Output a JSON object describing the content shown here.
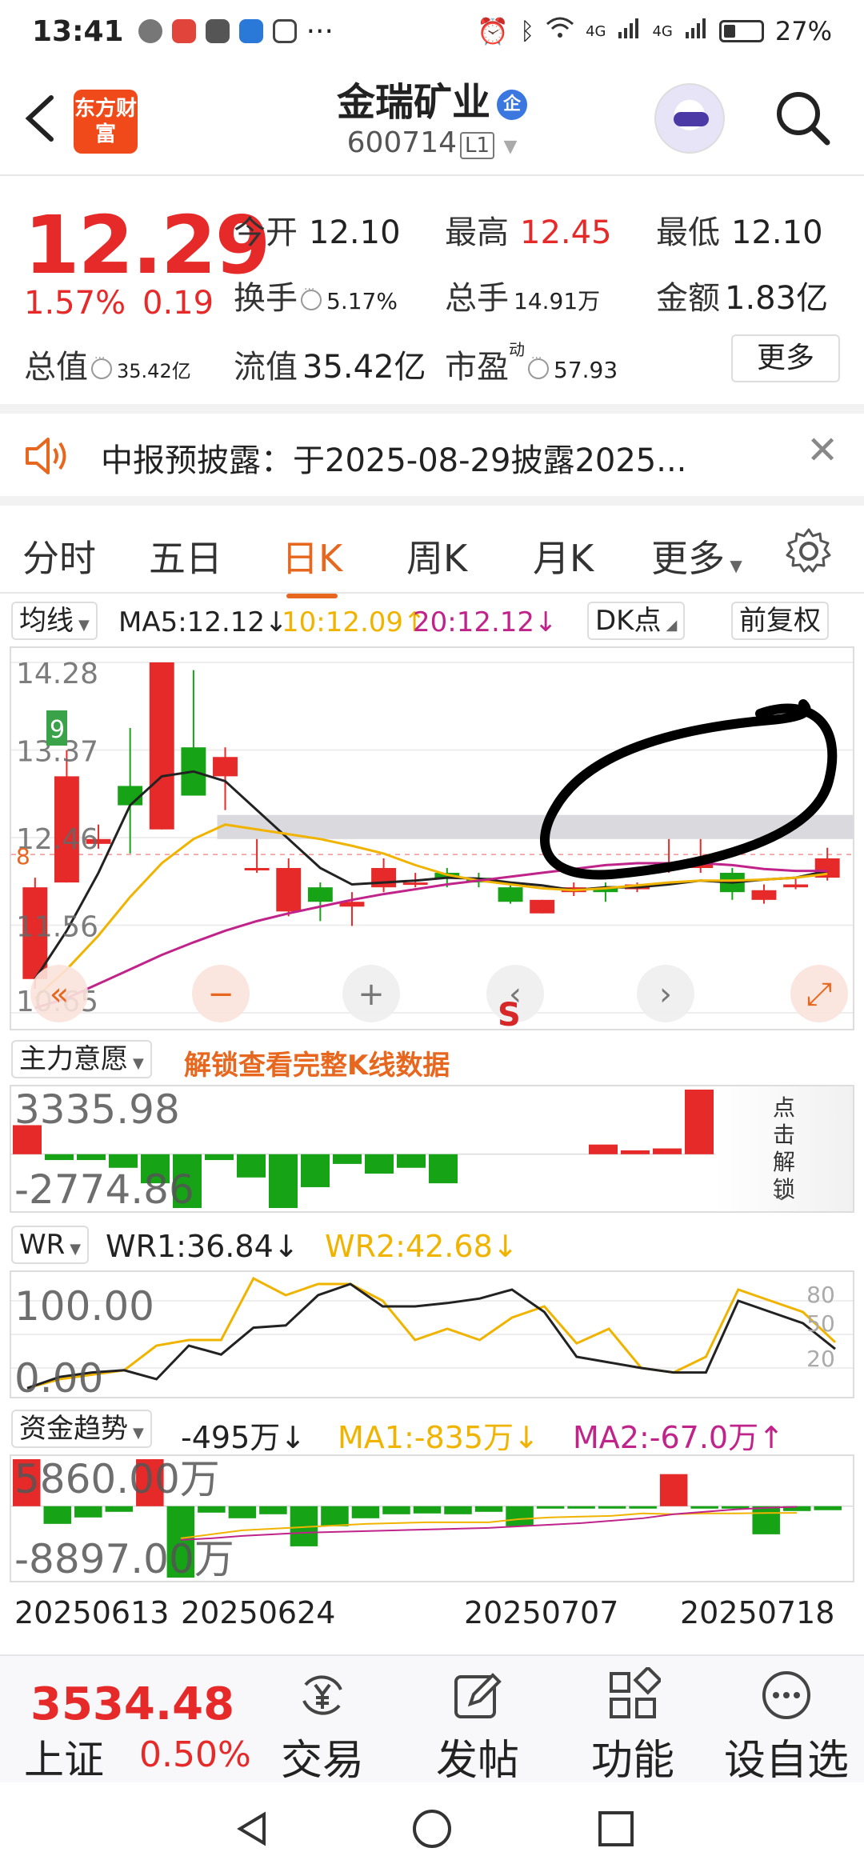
{
  "status_bar": {
    "time": "13:41",
    "dots": "···",
    "signal1": "4G",
    "signal2": "4G",
    "battery": "27%"
  },
  "header": {
    "app_logo_text": "东方财富",
    "stock_name": "金瑞矿业",
    "badge": "企",
    "stock_code": "600714",
    "level": "L1"
  },
  "quote": {
    "price": "12.29",
    "change_pct": "1.57%",
    "change_amt": "0.19",
    "open_label": "今开",
    "open": "12.10",
    "high_label": "最高",
    "high": "12.45",
    "low_label": "最低",
    "low": "12.10",
    "turnover_label": "换手",
    "turnover": "5.17%",
    "volume_label": "总手",
    "volume": "14.91万",
    "amount_label": "金额",
    "amount": "1.83亿",
    "mcap_label": "总值",
    "mcap": "35.42亿",
    "float_label": "流值",
    "float_mcap": "35.42亿",
    "pe_label": "市盈",
    "pe_sup": "动",
    "pe": "57.93",
    "more": "更多"
  },
  "notice": {
    "text": "中报预披露：于2025-08-29披露2025..."
  },
  "tabs": [
    "分时",
    "五日",
    "日K",
    "周K",
    "月K",
    "更多"
  ],
  "active_tab": "日K",
  "ma_bar": {
    "selector": "均线",
    "ma5": "MA5:12.12↓",
    "ma10": "10:12.09↑",
    "ma20": "20:12.12↓",
    "dk": "DK点",
    "adjust": "前复权"
  },
  "kline_axis": [
    "14.28",
    "13.37",
    "12.46",
    "11.56",
    "10.65"
  ],
  "kline_markers": {
    "nine": "9",
    "eight": "8",
    "s": "S"
  },
  "capital_bar": {
    "selector": "主力意愿",
    "unlock_text": "解锁查看完整K线数据",
    "axis_top": "3335.98",
    "axis_bottom": "-2774.86",
    "unlock_side": "点击解锁"
  },
  "wr_bar": {
    "selector": "WR",
    "wr1": "WR1:36.84↓",
    "wr2": "WR2:42.68↓",
    "axis_top": "100.00",
    "axis_bottom": "0.00",
    "levels": [
      "80",
      "50",
      "20"
    ]
  },
  "fund_bar": {
    "selector": "资金趋势",
    "value": "-495万↓",
    "ma1": "MA1:-835万↓",
    "ma2": "MA2:-67.0万↑",
    "axis_top": "5860.00万",
    "axis_bottom": "-8897.00万"
  },
  "dates": [
    "20250613",
    "20250624",
    "20250707",
    "20250718"
  ],
  "bottom": {
    "index_value": "3534.48",
    "index_name": "上证",
    "index_change": "0.50%",
    "nav": [
      "交易",
      "发帖",
      "功能",
      "设自选"
    ]
  },
  "colors": {
    "up": "#e62a2a",
    "down": "#16a316",
    "accent": "#e8671f",
    "ma5": "#222222",
    "ma10": "#f0b400",
    "ma20": "#c0238a"
  },
  "chart_data": [
    {
      "type": "candlestick",
      "title": "",
      "ylim": [
        10.65,
        14.28
      ],
      "candles": [
        {
          "o": 11.0,
          "c": 11.95,
          "h": 12.05,
          "l": 10.9
        },
        {
          "o": 12.0,
          "c": 13.1,
          "h": 13.37,
          "l": 12.0
        },
        {
          "o": 12.4,
          "c": 12.45,
          "h": 12.6,
          "l": 12.35
        },
        {
          "o": 13.0,
          "c": 12.8,
          "h": 13.6,
          "l": 12.3
        },
        {
          "o": 12.55,
          "c": 14.28,
          "h": 14.28,
          "l": 12.55
        },
        {
          "o": 13.4,
          "c": 12.9,
          "h": 14.2,
          "l": 12.9
        },
        {
          "o": 13.1,
          "c": 13.3,
          "h": 13.4,
          "l": 12.75
        },
        {
          "o": 12.15,
          "c": 12.15,
          "h": 12.45,
          "l": 12.1
        },
        {
          "o": 11.7,
          "c": 12.15,
          "h": 12.25,
          "l": 11.65
        },
        {
          "o": 11.95,
          "c": 11.8,
          "h": 12.0,
          "l": 11.6
        },
        {
          "o": 11.75,
          "c": 11.8,
          "h": 11.9,
          "l": 11.55
        },
        {
          "o": 11.95,
          "c": 12.15,
          "h": 12.25,
          "l": 11.9
        },
        {
          "o": 12.0,
          "c": 12.0,
          "h": 12.1,
          "l": 11.95
        },
        {
          "o": 12.1,
          "c": 12.05,
          "h": 12.15,
          "l": 11.95
        },
        {
          "o": 12.05,
          "c": 12.0,
          "h": 12.1,
          "l": 11.95
        },
        {
          "o": 11.95,
          "c": 11.8,
          "h": 11.98,
          "l": 11.78
        },
        {
          "o": 11.68,
          "c": 11.82,
          "h": 11.82,
          "l": 11.68
        },
        {
          "o": 11.9,
          "c": 11.95,
          "h": 12.0,
          "l": 11.86
        },
        {
          "o": 11.95,
          "c": 11.9,
          "h": 12.0,
          "l": 11.8
        },
        {
          "o": 11.93,
          "c": 11.98,
          "h": 12.0,
          "l": 11.9
        },
        {
          "o": 12.15,
          "c": 12.2,
          "h": 12.45,
          "l": 12.1
        },
        {
          "o": 12.15,
          "c": 12.2,
          "h": 12.45,
          "l": 12.1
        },
        {
          "o": 12.1,
          "c": 11.9,
          "h": 12.15,
          "l": 11.82
        },
        {
          "o": 11.82,
          "c": 11.92,
          "h": 11.98,
          "l": 11.78
        },
        {
          "o": 11.95,
          "c": 11.98,
          "h": 12.05,
          "l": 11.93
        },
        {
          "o": 12.05,
          "c": 12.25,
          "h": 12.36,
          "l": 12.02
        }
      ],
      "ma5": [
        11.0,
        11.5,
        12.1,
        12.8,
        13.1,
        13.15,
        13.05,
        12.75,
        12.45,
        12.15,
        11.98,
        12.0,
        12.02,
        12.05,
        12.04,
        12.0,
        11.97,
        11.92,
        11.95,
        11.95,
        11.98,
        12.02,
        12.0,
        12.03,
        12.05,
        12.12
      ],
      "ma10": [
        10.8,
        11.1,
        11.45,
        11.85,
        12.2,
        12.45,
        12.6,
        12.55,
        12.5,
        12.45,
        12.38,
        12.3,
        12.18,
        12.08,
        12.02,
        11.98,
        11.94,
        11.92,
        11.94,
        11.97,
        12.0,
        12.02,
        12.02,
        12.03,
        12.05,
        12.09
      ],
      "ma20": [
        10.7,
        10.8,
        10.95,
        11.1,
        11.25,
        11.38,
        11.5,
        11.6,
        11.68,
        11.75,
        11.82,
        11.88,
        11.93,
        11.98,
        12.02,
        12.06,
        12.1,
        12.14,
        12.18,
        12.2,
        12.2,
        12.2,
        12.18,
        12.14,
        12.12,
        12.12
      ]
    },
    {
      "type": "bar",
      "title": "",
      "ylim": [
        -2774.86,
        3335.98
      ],
      "values": [
        1500,
        -300,
        -300,
        -700,
        -1500,
        -2774.86,
        -300,
        -1200,
        -2774.86,
        -1700,
        -500,
        -1000,
        -700,
        -1500,
        null,
        null,
        null,
        null,
        500,
        200,
        300,
        3335.98
      ]
    },
    {
      "type": "line",
      "title": "",
      "ylim": [
        0,
        100
      ],
      "wr1": [
        2,
        12,
        16,
        18,
        10,
        40,
        32,
        56,
        58,
        85,
        95,
        75,
        75,
        78,
        82,
        90,
        70,
        30,
        25,
        20,
        16,
        16,
        80,
        70,
        60,
        37
      ],
      "wr2": [
        2,
        10,
        14,
        18,
        40,
        45,
        45,
        100,
        85,
        95,
        95,
        80,
        45,
        55,
        45,
        65,
        75,
        42,
        55,
        20,
        16,
        30,
        90,
        80,
        70,
        43
      ]
    },
    {
      "type": "bar",
      "title": "",
      "ylim": [
        -8897,
        5860
      ],
      "values": [
        5860,
        -2200,
        -1400,
        -700,
        5860,
        -8897,
        -800,
        -1500,
        -1000,
        -5000,
        -2500,
        -1500,
        -1000,
        -900,
        -1000,
        -700,
        -2500,
        -300,
        -200,
        -200,
        -200,
        4000,
        -300,
        -300,
        -3500,
        -600,
        -495
      ],
      "ma1": [
        null,
        null,
        null,
        null,
        null,
        -4000,
        -3500,
        -3000,
        -2800,
        -2600,
        -2400,
        -2200,
        -2100,
        -2000,
        -2000,
        -2000,
        -1600,
        -1400,
        -1300,
        -1200,
        -900,
        -1000,
        -900,
        -900,
        -850,
        -835
      ],
      "ma2": [
        null,
        null,
        null,
        null,
        null,
        -4200,
        -4000,
        -3700,
        -3500,
        -3300,
        -3200,
        -3100,
        -3000,
        -2900,
        -2800,
        -2700,
        -2500,
        -2300,
        -2100,
        -1800,
        -1500,
        -1000,
        -700,
        -400,
        -200,
        -67
      ]
    }
  ]
}
